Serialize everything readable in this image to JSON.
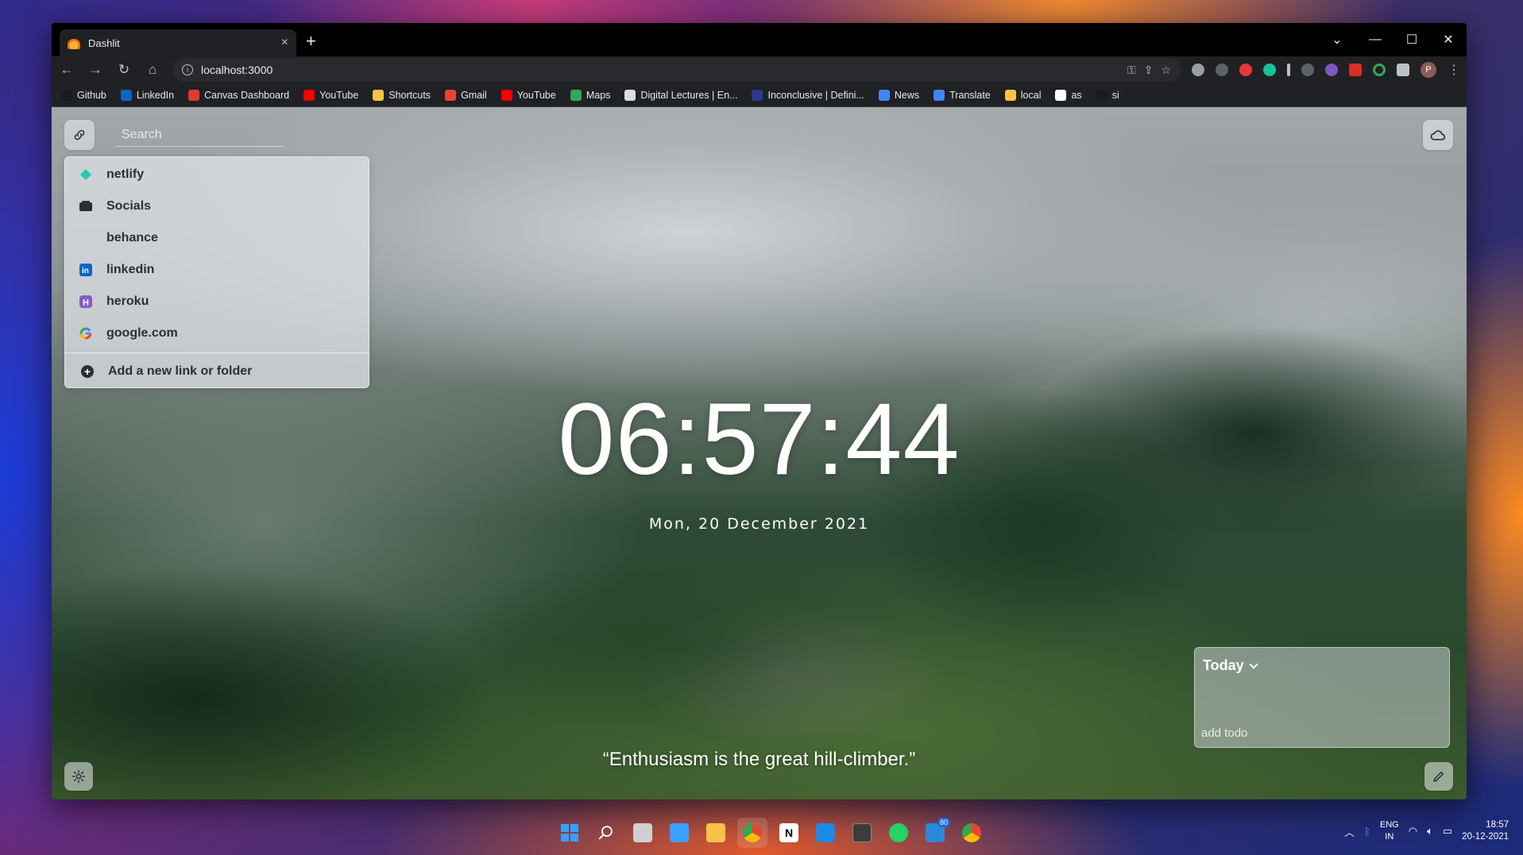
{
  "browser": {
    "tab_title": "Dashlit",
    "tab_close": "×",
    "new_tab": "+",
    "url": "localhost:3000",
    "window_controls": {
      "tab_search": "⌄",
      "minimize": "—",
      "maximize": "☐",
      "close": "✕"
    },
    "nav": {
      "back": "←",
      "forward": "→",
      "reload": "↻",
      "home": "⌂"
    },
    "profile_initial": "P",
    "bookmarks": [
      {
        "label": "Github",
        "color": "#1b1b1b"
      },
      {
        "label": "LinkedIn",
        "color": "#0a66c2"
      },
      {
        "label": "Canvas Dashboard",
        "color": "#e03a2f"
      },
      {
        "label": "YouTube",
        "color": "#ff0000"
      },
      {
        "label": "Shortcuts",
        "color": "#f6c344"
      },
      {
        "label": "Gmail",
        "color": "#ea4335"
      },
      {
        "label": "YouTube",
        "color": "#ff0000"
      },
      {
        "label": "Maps",
        "color": "#34a853"
      },
      {
        "label": "Digital Lectures | En...",
        "color": "#dcdcdc"
      },
      {
        "label": "Inconclusive | Defini...",
        "color": "#2a3b8f"
      },
      {
        "label": "News",
        "color": "#4285f4"
      },
      {
        "label": "Translate",
        "color": "#4285f4"
      },
      {
        "label": "local",
        "color": "#f6c344"
      },
      {
        "label": "as",
        "color": "#ffffff"
      },
      {
        "label": "si",
        "color": "#1b1b1b"
      }
    ]
  },
  "dashboard": {
    "search_placeholder": "Search",
    "links": [
      {
        "label": "netlify",
        "icon": "netlify-icon",
        "color": "#25c7b7"
      },
      {
        "label": "Socials",
        "icon": "folder-icon",
        "color": "#2a2f33"
      },
      {
        "label": "behance",
        "icon": "",
        "color": ""
      },
      {
        "label": "linkedin",
        "icon": "linkedin-icon",
        "color": "#0a66c2"
      },
      {
        "label": "heroku",
        "icon": "heroku-icon",
        "color": "#8a5cc5"
      },
      {
        "label": "google.com",
        "icon": "google-icon",
        "color": "#4285f4"
      }
    ],
    "add_link_label": "Add a new link or folder",
    "clock": "06:57:44",
    "date": "Mon, 20 December 2021",
    "quote": "“Enthusiasm is the great hill-climber.”",
    "todo": {
      "title": "Today",
      "placeholder": "add todo"
    }
  },
  "taskbar": {
    "mail_badge": "80",
    "lang_line1": "ENG",
    "lang_line2": "IN",
    "time": "18:57",
    "date": "20-12-2021"
  }
}
